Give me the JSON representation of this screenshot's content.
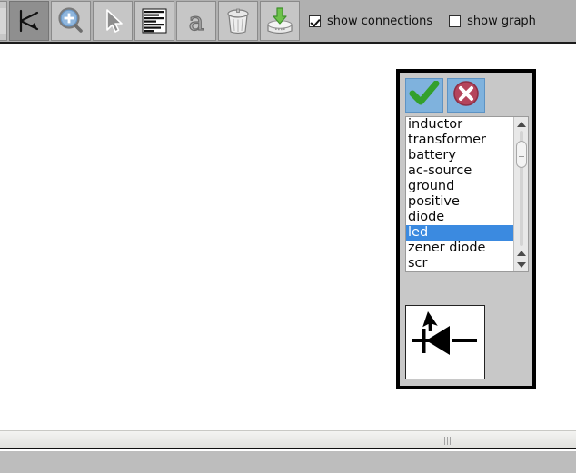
{
  "toolbar": {
    "buttons": [
      {
        "name": "circuit-edit-icon",
        "label": "Edit Circuit",
        "pressed": false
      },
      {
        "name": "connector-tool-icon",
        "label": "Connection Tool",
        "pressed": true
      },
      {
        "name": "zoom-in-icon",
        "label": "Zoom In",
        "pressed": false
      },
      {
        "name": "select-arrow-icon",
        "label": "Select",
        "pressed": false
      },
      {
        "name": "list-lines-icon",
        "label": "Netlist",
        "pressed": false
      },
      {
        "name": "text-tool-icon",
        "label": "Text Tool",
        "pressed": false
      },
      {
        "name": "trash-icon",
        "label": "Delete",
        "pressed": false
      },
      {
        "name": "save-to-disk-icon",
        "label": "Save",
        "pressed": false
      }
    ],
    "checkboxes": [
      {
        "name": "show-connections",
        "label": "show connections",
        "checked": true
      },
      {
        "name": "show-graph",
        "label": "show graph",
        "checked": false
      }
    ]
  },
  "picker": {
    "ok_button": {
      "label": "OK",
      "icon": "check-icon"
    },
    "cancel_button": {
      "label": "Cancel",
      "icon": "close-circle-icon"
    },
    "list": {
      "items": [
        "inductor",
        "transformer",
        "battery",
        "ac-source",
        "ground",
        "positive",
        "diode",
        "led",
        "zener diode",
        "scr"
      ],
      "selected": "led",
      "selected_index": 7
    },
    "preview": {
      "symbol": "led-symbol",
      "label": "led"
    }
  },
  "statusbar": {
    "grip": "|||"
  },
  "colors": {
    "toolbar_bg": "#b0b0b0",
    "button_bg": "#c6c6c6",
    "button_pressed_bg": "#8f8f8f",
    "panel_bg": "#c8c8c8",
    "panel_border": "#000000",
    "dialog_button_bg": "#7fb2dd",
    "selection_blue": "#3b8ae0",
    "canvas_bg": "#ffffff",
    "statusbar_bg": "#bdbdbd",
    "check_green": "#3aa83a",
    "cancel_red": "#b5455c"
  }
}
